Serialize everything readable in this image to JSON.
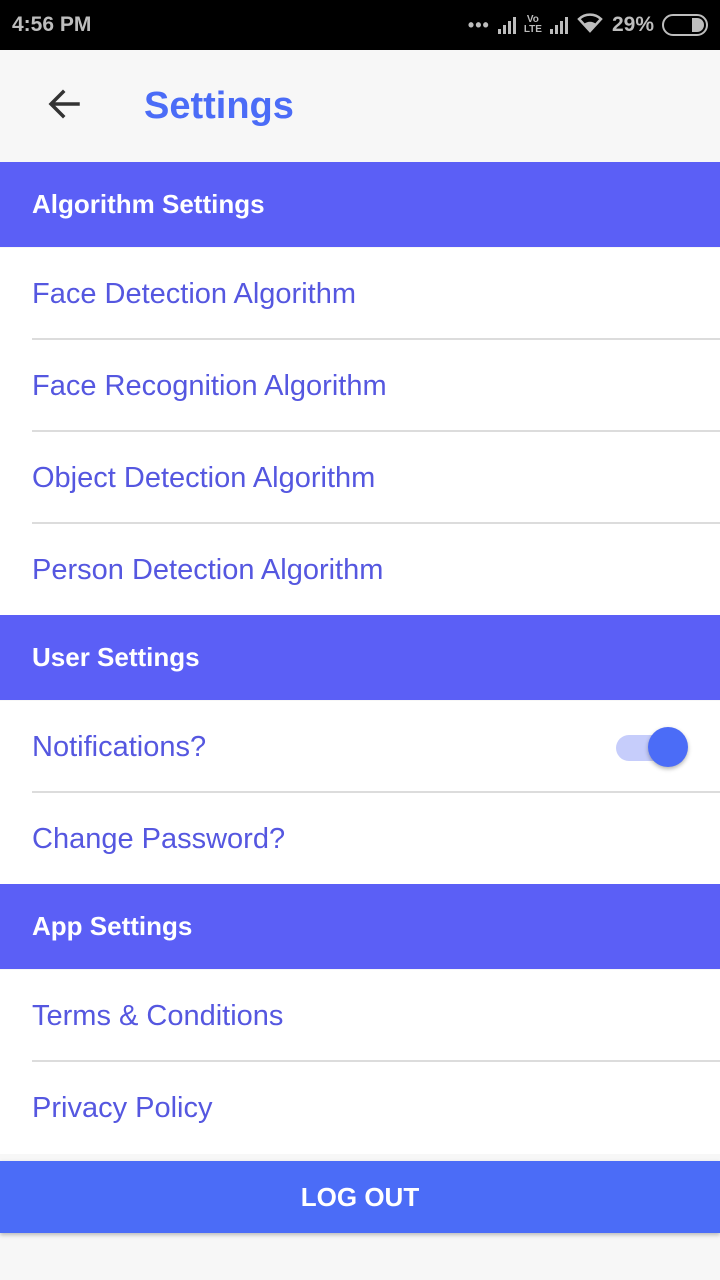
{
  "status_bar": {
    "time": "4:56 PM",
    "network": "LTE",
    "network_top": "Vo",
    "battery": "29%"
  },
  "app_bar": {
    "title": "Settings",
    "back_icon": "arrow-back-icon"
  },
  "sections": [
    {
      "header": "Algorithm Settings",
      "items": [
        {
          "label": "Face Detection Algorithm"
        },
        {
          "label": "Face Recognition Algorithm"
        },
        {
          "label": "Object Detection Algorithm"
        },
        {
          "label": "Person Detection Algorithm"
        }
      ]
    },
    {
      "header": "User Settings",
      "items": [
        {
          "label": "Notifications?",
          "toggle_on": true
        },
        {
          "label": "Change Password?"
        }
      ]
    },
    {
      "header": "App Settings",
      "items": [
        {
          "label": "Terms & Conditions"
        },
        {
          "label": "Privacy Policy"
        }
      ]
    }
  ],
  "logout_label": "LOG OUT",
  "colors": {
    "accent": "#4b6cf7",
    "section_header": "#5b5ff6",
    "item_text": "#5557e0"
  }
}
